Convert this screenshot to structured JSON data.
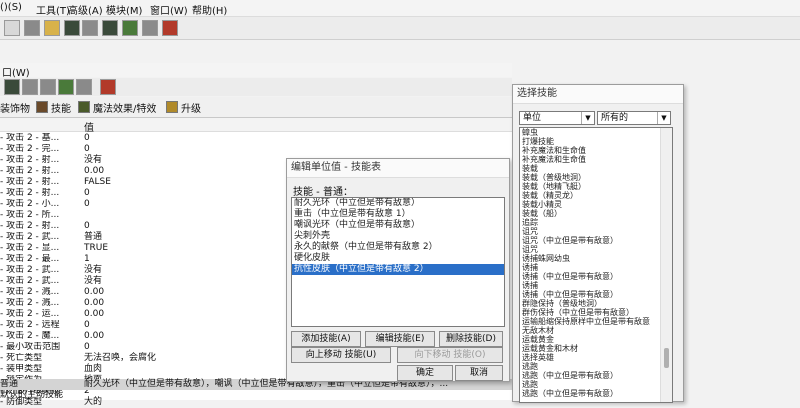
{
  "menu": [
    "()(S)",
    "工具(T)",
    "高级(A)",
    "模块(M)",
    "窗口(W)",
    "帮助(H)"
  ],
  "window_menu": "口(W)",
  "tabs": [
    "装饰物",
    "技能",
    "魔法效果/特效",
    "升级"
  ],
  "grid": {
    "value_header": "值",
    "rows": [
      {
        "k": "- 攻击 2 - 基...",
        "v": "0"
      },
      {
        "k": "- 攻击 2 - 完...",
        "v": "0"
      },
      {
        "k": "- 攻击 2 - 射...",
        "v": "没有"
      },
      {
        "k": "- 攻击 2 - 射...",
        "v": "0.00"
      },
      {
        "k": "- 攻击 2 - 射...",
        "v": "FALSE"
      },
      {
        "k": "- 攻击 2 - 射...",
        "v": "0"
      },
      {
        "k": "- 攻击 2 - 小...",
        "v": "0"
      },
      {
        "k": "- 攻击 2 - 所...",
        "v": ""
      },
      {
        "k": "- 攻击 2 - 射...",
        "v": "0"
      },
      {
        "k": "- 攻击 2 - 武...",
        "v": "普通"
      },
      {
        "k": "- 攻击 2 - 显...",
        "v": "TRUE"
      },
      {
        "k": "- 攻击 2 - 最...",
        "v": "1"
      },
      {
        "k": "- 攻击 2 - 武...",
        "v": "没有"
      },
      {
        "k": "- 攻击 2 - 武...",
        "v": "没有"
      },
      {
        "k": "- 攻击 2 - 溅...",
        "v": "0.00"
      },
      {
        "k": "- 攻击 2 - 溅...",
        "v": "0.00"
      },
      {
        "k": "- 攻击 2 - 运...",
        "v": "0.00"
      },
      {
        "k": "- 攻击 2 - 远程",
        "v": "0"
      },
      {
        "k": "- 攻击 2 - 魔...",
        "v": "0.00"
      },
      {
        "k": "- 最小攻击范围",
        "v": "0"
      },
      {
        "k": "- 死亡类型",
        "v": "无法召唤，会腐化"
      },
      {
        "k": "- 装甲类型",
        "v": "血肉"
      },
      {
        "k": "- 锁定作为",
        "v": "地面"
      },
      {
        "k": "- 防御升级奖励",
        "v": "2"
      },
      {
        "k": "- 防御类型",
        "v": "大的"
      }
    ],
    "selected_row": {
      "k": "普通",
      "v": "耐久光环（中立但是带有敌意），嘲讽（中立但是带有敌意），重击（中立但是带有敌意），..."
    },
    "bottom_row": {
      "k": "默认的主动技能",
      "v": ""
    }
  },
  "edit_dialog": {
    "title": "编辑单位值 - 技能表",
    "label": "技能 - 普通：",
    "items": [
      "耐久光环（中立但是带有敌意）",
      "重击（中立但是带有敌意 1）",
      "嘲讽光环（中立但是带有敌意）",
      "尖刺外壳",
      "永久的献祭（中立但是带有敌意 2）",
      "硬化皮肤",
      "抗性皮肤（中立但是带有敌意 2）"
    ],
    "selected_index": 6,
    "add_button": "添加技能(A)",
    "edit_button": "编辑技能(E)",
    "delete_button": "删除技能(D)",
    "up_button": "向上移动 技能(U)",
    "down_button": "向下移动 技能(O)",
    "ok_button": "确定",
    "cancel_button": "取消"
  },
  "select_dialog": {
    "title": "选择技能",
    "filter1": "单位",
    "filter2": "所有的",
    "items": [
      "蟑虫",
      "打爆技能",
      "补充魔法和生命值",
      "补充魔法和生命值",
      "装载",
      "装载（普级地洞）",
      "装载（地精飞艇）",
      "装载（精灵龙）",
      "装载小精灵",
      "装载（船）",
      "追踪",
      "诅咒",
      "诅咒（中立但是带有敌意）",
      "诅咒",
      "诱捕蛛网幼虫",
      "诱捕",
      "诱捕（中立但是带有敌意）",
      "诱捕",
      "诱捕（中立但是带有敌意）",
      "群隐保持（普级地洞）",
      "群伤保持（中立但是带有敌意）",
      "运输船缩保持原样中立但是带有敌意",
      "无敌木材",
      "运载黄金",
      "运载黄金和木材",
      "选择英雄",
      "逃跑",
      "逃跑（中立但是带有敌意）",
      "逃跑",
      "逃跑（中立但是带有敌意）"
    ]
  }
}
